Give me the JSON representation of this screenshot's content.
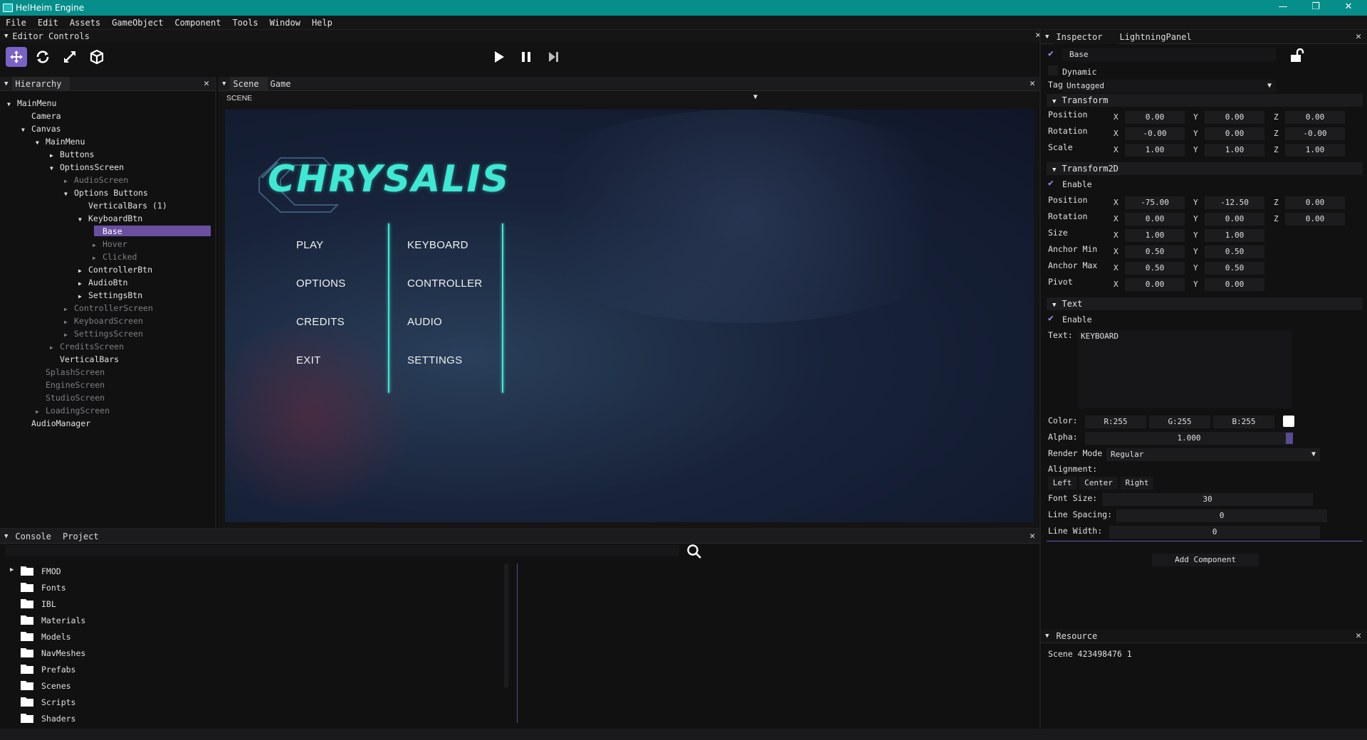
{
  "window": {
    "title": "HelHeim Engine",
    "minimize": "—",
    "restore": "❐",
    "close": "✕"
  },
  "menu": [
    "File",
    "Edit",
    "Assets",
    "GameObject",
    "Component",
    "Tools",
    "Window",
    "Help"
  ],
  "editor_controls": {
    "title": "Editor Controls"
  },
  "hierarchy": {
    "title": "Hierarchy",
    "items": [
      {
        "label": "MainMenu",
        "arrow": "▼",
        "dim": false
      },
      {
        "label": "Camera",
        "arrow": "",
        "dim": false
      },
      {
        "label": "Canvas",
        "arrow": "▼",
        "dim": false
      },
      {
        "label": "MainMenu",
        "arrow": "▼",
        "dim": false
      },
      {
        "label": "Buttons",
        "arrow": "▶",
        "dim": false
      },
      {
        "label": "OptionsScreen",
        "arrow": "▼",
        "dim": false
      },
      {
        "label": "AudioScreen",
        "arrow": "▶",
        "dim": true
      },
      {
        "label": "Options Buttons",
        "arrow": "▼",
        "dim": false
      },
      {
        "label": "VerticalBars (1)",
        "arrow": "",
        "dim": false
      },
      {
        "label": "KeyboardBtn",
        "arrow": "▼",
        "dim": false
      },
      {
        "label": "Base",
        "arrow": "",
        "dim": false
      },
      {
        "label": "Hover",
        "arrow": "▶",
        "dim": true
      },
      {
        "label": "Clicked",
        "arrow": "▶",
        "dim": true
      },
      {
        "label": "ControllerBtn",
        "arrow": "▶",
        "dim": false
      },
      {
        "label": "AudioBtn",
        "arrow": "▶",
        "dim": false
      },
      {
        "label": "SettingsBtn",
        "arrow": "▶",
        "dim": false
      },
      {
        "label": "ControllerScreen",
        "arrow": "▶",
        "dim": true
      },
      {
        "label": "KeyboardScreen",
        "arrow": "▶",
        "dim": true
      },
      {
        "label": "SettingsScreen",
        "arrow": "▶",
        "dim": true
      },
      {
        "label": "CreditsScreen",
        "arrow": "▶",
        "dim": true
      },
      {
        "label": "VerticalBars",
        "arrow": "",
        "dim": false
      },
      {
        "label": "SplashScreen",
        "arrow": "",
        "dim": true
      },
      {
        "label": "EngineScreen",
        "arrow": "",
        "dim": true
      },
      {
        "label": "StudioScreen",
        "arrow": "",
        "dim": true
      },
      {
        "label": "LoadingScreen",
        "arrow": "▶",
        "dim": true
      },
      {
        "label": "AudioManager",
        "arrow": "",
        "dim": false
      }
    ]
  },
  "scene": {
    "tabs": [
      "Scene",
      "Game"
    ],
    "dropdown_value": "SCENE",
    "logo_text": "CHRYSALIS",
    "menu_col1": [
      "PLAY",
      "OPTIONS",
      "CREDITS",
      "EXIT"
    ],
    "menu_col2": [
      "KEYBOARD",
      "CONTROLLER",
      "AUDIO",
      "SETTINGS"
    ]
  },
  "inspector": {
    "title": "Inspector",
    "object_name": "LightningPanel",
    "name_value": "Base",
    "dynamic_label": "Dynamic",
    "tag_label": "Tag",
    "tag_value": "Untagged",
    "transform": {
      "title": "Transform",
      "position_label": "Position",
      "position": [
        "0.00",
        "0.00",
        "0.00"
      ],
      "rotation_label": "Rotation",
      "rotation": [
        "-0.00",
        "0.00",
        "-0.00"
      ],
      "scale_label": "Scale",
      "scale": [
        "1.00",
        "1.00",
        "1.00"
      ]
    },
    "transform2d": {
      "title": "Transform2D",
      "enable_label": "Enable",
      "position_label": "Position",
      "position": [
        "-75.00",
        "-12.50",
        "0.00"
      ],
      "rotation_label": "Rotation",
      "rotation": [
        "0.00",
        "0.00",
        "0.00"
      ],
      "size_label": "Size",
      "size": [
        "1.00",
        "1.00"
      ],
      "anchor_min_label": "Anchor Min",
      "anchor_min": [
        "0.50",
        "0.50"
      ],
      "anchor_max_label": "Anchor Max",
      "anchor_max": [
        "0.50",
        "0.50"
      ],
      "pivot_label": "Pivot",
      "pivot": [
        "0.00",
        "0.00"
      ]
    },
    "text": {
      "title": "Text",
      "enable_label": "Enable",
      "text_label": "Text:",
      "text_value": "KEYBOARD",
      "color_label": "Color:",
      "color_r": "R:255",
      "color_g": "G:255",
      "color_b": "B:255",
      "alpha_label": "Alpha:",
      "alpha_value": "1.000",
      "render_mode_label": "Render Mode",
      "render_mode_value": "Regular",
      "alignment_label": "Alignment:",
      "align_left": "Left",
      "align_center": "Center",
      "align_right": "Right",
      "font_size_label": "Font Size:",
      "font_size_value": "30",
      "line_spacing_label": "Line Spacing:",
      "line_spacing_value": "0",
      "line_width_label": "Line Width:",
      "line_width_value": "0"
    },
    "add_component": "Add Component"
  },
  "resource": {
    "title": "Resource",
    "entry": "Scene 423498476 1"
  },
  "console": {
    "tabs": [
      "Console",
      "Project"
    ],
    "folders": [
      "FMOD",
      "Fonts",
      "IBL",
      "Materials",
      "Models",
      "NavMeshes",
      "Prefabs",
      "Scenes",
      "Scripts",
      "Shaders"
    ]
  },
  "axes": {
    "x": "X",
    "y": "Y",
    "z": "Z"
  },
  "colors": {
    "accent": "#068e8a",
    "selection": "#6a4fa0",
    "check": "#a58be8",
    "logo": "#3fe8d2"
  }
}
